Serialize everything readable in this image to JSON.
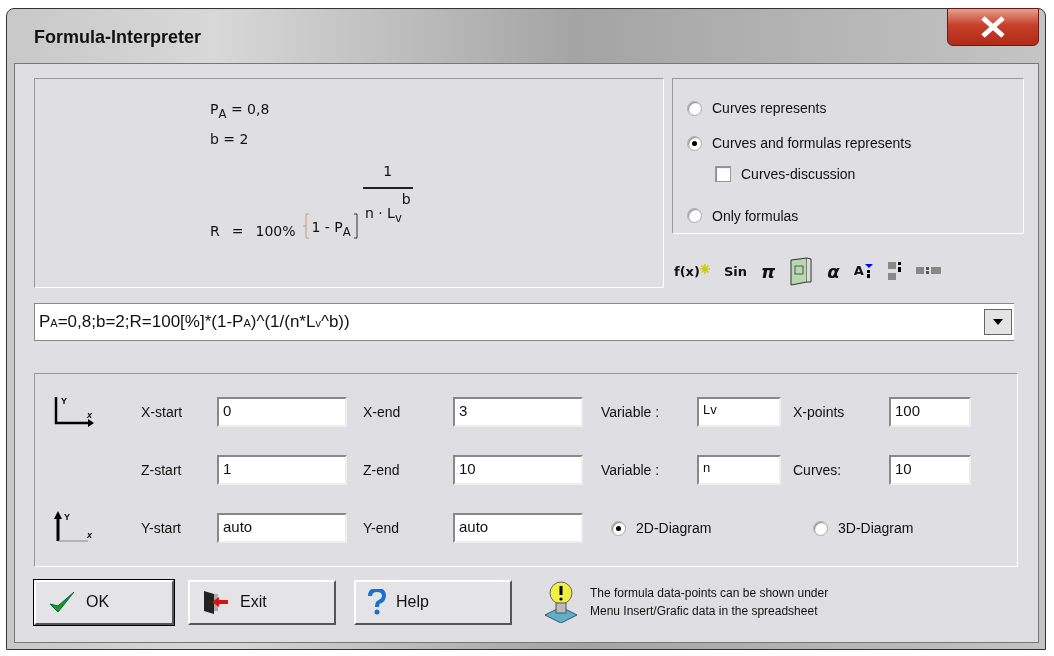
{
  "window": {
    "title": "Formula-Interpreter"
  },
  "formula_preview": {
    "lines": [
      "P$_{A}$ = 0,8",
      "b = 2"
    ],
    "result": {
      "lhs": "R",
      "eq": "=",
      "factor": "100%",
      "base": "1 - P$_{A}$",
      "exp_numerator": "1",
      "exp_denominator": "n · L$_{v}$",
      "exp_power": "b"
    }
  },
  "display_options": [
    {
      "label": "Curves represents",
      "selected": false
    },
    {
      "label": "Curves and formulas represents",
      "selected": true
    },
    {
      "label": "Only formulas",
      "selected": false
    }
  ],
  "curves_discussion": {
    "label": "Curves-discussion",
    "checked": false
  },
  "toolbar": [
    {
      "kind": "fx",
      "label": "f(x)"
    },
    {
      "kind": "text",
      "label": "Sin"
    },
    {
      "kind": "text",
      "label": "π"
    },
    {
      "kind": "book"
    },
    {
      "kind": "text",
      "label": "α"
    },
    {
      "kind": "index",
      "label": "A"
    },
    {
      "kind": "blocks"
    },
    {
      "kind": "dashes"
    }
  ],
  "expression": "P$_{A}$=0,8;b=2;R=100[%]*(1-P$_{A}$)^(1/(n*L$_{v}$^b))",
  "ranges": [
    {
      "axis": {
        "kind": "xy",
        "y": "Y",
        "x": "x"
      },
      "start_label": "X-start",
      "start": "0",
      "end_label": "X-end",
      "end": "3",
      "var_label": "Variable :",
      "var": "Lv",
      "count_label": "X-points",
      "count": "100"
    },
    {
      "start_label": "Z-start",
      "start": "1",
      "end_label": "Z-end",
      "end": "10",
      "var_label": "Variable :",
      "var": "n",
      "count_label": "Curves:",
      "count": "10"
    },
    {
      "axis": {
        "kind": "yx",
        "y": "Y",
        "x": "x"
      },
      "start_label": "Y-start",
      "start": "auto",
      "end_label": "Y-end",
      "end": "auto"
    }
  ],
  "diagram_types": [
    {
      "label": "2D-Diagram",
      "selected": true
    },
    {
      "label": "3D-Diagram",
      "selected": false
    }
  ],
  "buttons": [
    {
      "kind": "ok",
      "label": "OK"
    },
    {
      "kind": "exit",
      "label": "Exit"
    },
    {
      "kind": "help",
      "label": "Help"
    }
  ],
  "hint": "The formula data-points can be shown under\nMenu Insert/Grafic data in the spreadsheet"
}
